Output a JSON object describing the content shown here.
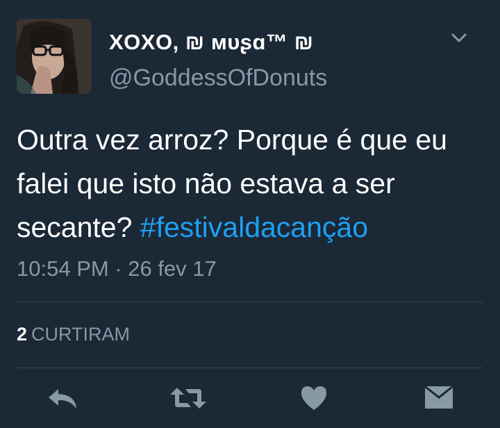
{
  "tweet": {
    "display_name": "XOXO, ₪ ᴍᴜʂɑ™ ₪",
    "handle": "@GoddessOfDonuts",
    "text_plain": "Outra vez arroz? Porque é que eu falei que isto não estava a ser secante? ",
    "hashtag": "#festivaldacanção",
    "timestamp": "10:54 PM · 26 fev 17",
    "likes_count": "2",
    "likes_label": "CURTIRAM"
  },
  "icons": {
    "menu": "chevron-down-icon",
    "reply": "reply-icon",
    "retweet": "retweet-icon",
    "like": "heart-icon",
    "dm": "envelope-icon"
  },
  "colors": {
    "background": "#1b2836",
    "text": "#ffffff",
    "secondary": "#8899a6",
    "hashtag": "#1da1f2",
    "divider": "#38444d",
    "icon": "#8899a6"
  }
}
